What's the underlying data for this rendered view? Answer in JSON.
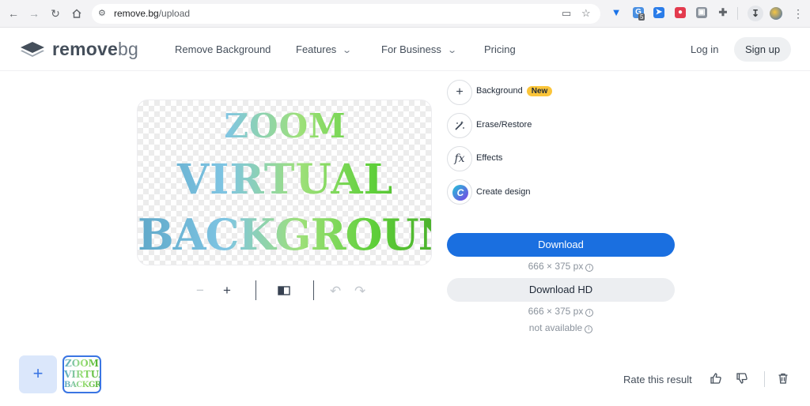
{
  "browser": {
    "url_host": "remove.bg",
    "url_path": "/upload",
    "icons": [
      "back-arrow-icon",
      "forward-arrow-icon",
      "reload-icon",
      "home-icon",
      "site-settings-icon",
      "install-app-icon",
      "bookmark-star-icon",
      "extensions-puzzle-icon",
      "downloads-icon",
      "menu-kebab-icon"
    ],
    "extension_badge_count": "5"
  },
  "header": {
    "logo_word_1": "remove",
    "logo_word_2": "bg",
    "nav": [
      {
        "label": "Remove Background"
      },
      {
        "label": "Features"
      },
      {
        "label": "For Business"
      },
      {
        "label": "Pricing"
      }
    ],
    "login_label": "Log in",
    "signup_label": "Sign up"
  },
  "preview": {
    "lines": [
      "ZOOM",
      "VIRTUAL",
      "BACKGROUND"
    ],
    "thumb_lines": [
      "ZOOM",
      "VIRTUAL",
      "BACKGROUND"
    ]
  },
  "controls": {
    "zoom_out": "−",
    "zoom_in": "+"
  },
  "tools": [
    {
      "label": "Background",
      "badge": "New",
      "icon": "plus-icon"
    },
    {
      "label": "Erase/Restore",
      "icon": "magic-brush-icon"
    },
    {
      "label": "Effects",
      "icon": "fx-icon"
    },
    {
      "label": "Create design",
      "icon": "canva-icon"
    }
  ],
  "download": {
    "label": "Download",
    "size": "666 × 375 px",
    "hd_label": "Download HD",
    "hd_size": "666 × 375 px",
    "hd_note": "not available"
  },
  "bottom": {
    "add_label": "+",
    "rate_label": "Rate this result"
  },
  "colors": {
    "primary": "#1a6fe0",
    "badge": "#fbc53a",
    "add_tile": "#dbe7fb"
  }
}
